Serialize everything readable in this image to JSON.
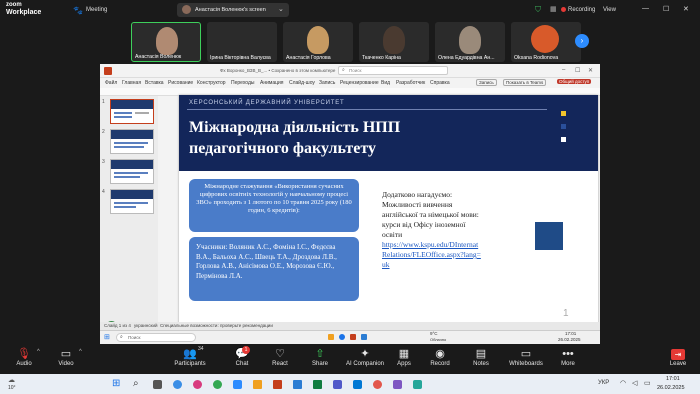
{
  "zoom": {
    "brand_line1": "zoom",
    "brand_line2": "Workplace",
    "meeting_label": "Meeting",
    "screen_share_label": "Анастасія Воленюк's screen",
    "recording_label": "Recording",
    "view_label": "View"
  },
  "participants": [
    {
      "name": "Анастасія Воленюк"
    },
    {
      "name": "Ірина Вікторівна Валуєва"
    },
    {
      "name": "Анастасія Горлова"
    },
    {
      "name": "Ткаченко Каріна"
    },
    {
      "name": "Олена Едуардівна Ан..."
    },
    {
      "name": "Oksana Rodionova"
    }
  ],
  "ppt": {
    "window_title": "Фх Воронко_ВЗВ_В_... • Сохранено в этом компьютере",
    "search_placeholder": "Поиск",
    "tabs": [
      "Файл",
      "Главная",
      "Вставка",
      "Рисование",
      "Конструктор",
      "Переходы",
      "Анимация",
      "Слайд-шоу",
      "Запись",
      "Рецензирование",
      "Вид",
      "Разработчик",
      "Справка"
    ],
    "record_btn": "Запись",
    "present_btn": "Показать в Teams",
    "share_btn": "Общий доступ",
    "thumb_numbers": [
      "1",
      "2",
      "3",
      "4"
    ],
    "status_left": "Слайд 1 из 4",
    "status_lang": "украинский",
    "status_notes": "Специальные возможности: проверьте рекомендации",
    "win_search": "Поиск",
    "win_weather_temp": "9°C",
    "win_weather_desc": "Облачно",
    "win_time": "17:01",
    "win_date": "26.02.2025"
  },
  "slide": {
    "university": "ХЕРСОНСЬКИЙ ДЕРЖАВНИЙ УНІВЕРСИТЕТ",
    "title_line1": "Міжнародна діяльність НПП",
    "title_line2": "педагогічного факультету",
    "box1_text": "Міжнародне стажування «Використання сучасних цифрових освітніх технологій у навчальному процесі ЗВО» проходить з 1 лютого по 10 травня 2025 року (180 годин, 6 кредитів):",
    "box2_text": "Учасники: Воляник А.С., Фоміна І.С., Федєєва В.А., Бальоха А.С., Швець Т.А., Дроздова Л.В., Горлова А.В., Анісімова О.Е., Морозова Є.Ю., Пермінова Л.А.",
    "note_lines": [
      "Додатково нагадуємо:",
      "Можливості вивчення",
      "англійської та німецької мови:",
      "курси від Офісу іноземної",
      "освіти"
    ],
    "link_lines": [
      "https://www.kspu.edu/DInternat",
      "Relations/FLEOffice.aspx?lang=",
      "uk"
    ],
    "slide_number": "1"
  },
  "controls": [
    {
      "label": "Audio",
      "icon": "microphone-icon"
    },
    {
      "label": "Video",
      "icon": "camera-icon"
    },
    {
      "label": "Participants",
      "icon": "people-icon"
    },
    {
      "label": "Chat",
      "icon": "chat-icon"
    },
    {
      "label": "React",
      "icon": "heart-icon"
    },
    {
      "label": "Share",
      "icon": "share-icon"
    },
    {
      "label": "AI Companion",
      "icon": "sparkle-icon"
    },
    {
      "label": "Apps",
      "icon": "apps-icon"
    },
    {
      "label": "Record",
      "icon": "record-icon"
    },
    {
      "label": "Notes",
      "icon": "notes-icon"
    },
    {
      "label": "Whiteboards",
      "icon": "whiteboard-icon"
    },
    {
      "label": "More",
      "icon": "more-icon"
    },
    {
      "label": "Leave",
      "icon": "leave-icon"
    }
  ],
  "participants_count": "34",
  "chat_badge": "1",
  "taskbar": {
    "weather": "10°",
    "lang": "УКР",
    "time": "17:01",
    "date": "26.02.2025"
  },
  "colors": {
    "slide_header": "#13265a",
    "box_blue": "#4a7cc9",
    "accent_square": "#1f4b87",
    "share_button": "#c0392b",
    "recording": "#e53935"
  }
}
